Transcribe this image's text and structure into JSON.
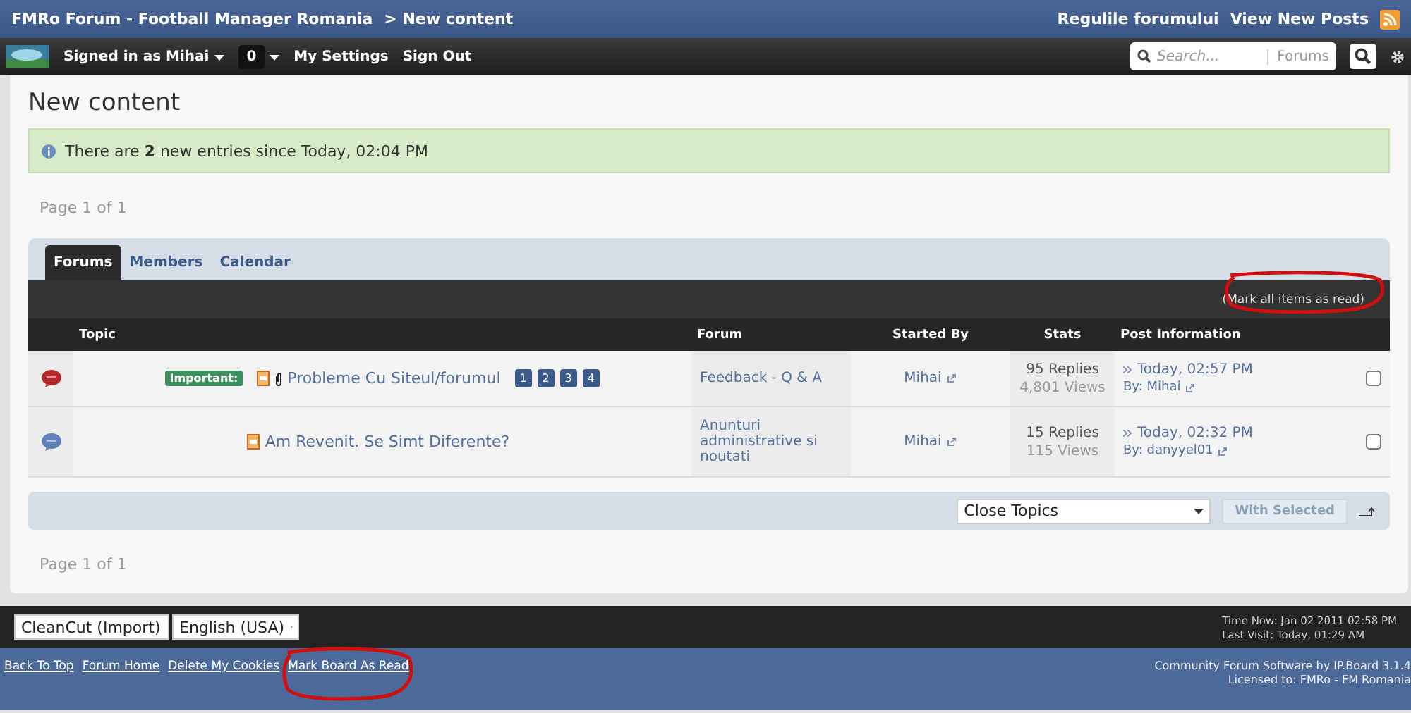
{
  "header": {
    "breadcrumb": "FMRo Forum - Football Manager Romania",
    "current": "> New content",
    "links": [
      "Regulile forumului",
      "View New Posts"
    ]
  },
  "user_bar": {
    "signed_in": "Signed in as Mihai",
    "notifications": "0",
    "links": [
      "My Settings",
      "Sign Out"
    ],
    "search": {
      "placeholder": "Search...",
      "scope": "Forums"
    }
  },
  "page": {
    "title": "New content",
    "message": "There are **2** new entries since Today, 02:04 PM",
    "pagination_top": "Page 1 of 1",
    "pagination_bottom": "Page 1 of 1"
  },
  "tabs": [
    {
      "label": "Forums",
      "selected": true
    },
    {
      "label": "Members",
      "selected": false
    },
    {
      "label": "Calendar",
      "selected": false
    }
  ],
  "mark_all": {
    "label": "(Mark all items as read)",
    "circled": true
  },
  "columns": [
    "Topic",
    "Forum",
    "Started By",
    "Stats",
    "Post Information"
  ],
  "topics": [
    {
      "color": "#b8282a",
      "badge": "Important:",
      "attachment": true,
      "title": "Probleme Cu Siteul/forumul",
      "pages": [
        "1",
        "2",
        "3",
        "4"
      ],
      "forum": "Feedback - Q & A",
      "starter": "Mihai",
      "replies": "95 Replies",
      "views": "4,801 Views",
      "last": "Today, 02:57 PM",
      "by": "By: Mihai",
      "checked": false
    },
    {
      "color": "#5f82b8",
      "attachment": false,
      "title": "Am Revenit. Se Simt Diferente?",
      "forum": "Anunturi administrative si noutati",
      "starter": "Mihai",
      "replies": "15 Replies",
      "views": "115 Views",
      "last": "Today, 02:32 PM",
      "by": "By: danyyel01",
      "checked": false
    }
  ],
  "moderation": {
    "action": "Close Topics",
    "button": "With Selected"
  },
  "footer": {
    "skin": "CleanCut (Import)",
    "language": "English (USA)",
    "time_now": "Time Now: Jan 02 2011 02:58 PM",
    "last_visit": "Last Visit: Today, 01:29 AM",
    "links": [
      {
        "label": "Back To Top",
        "circled": false
      },
      {
        "label": "Forum Home",
        "circled": false
      },
      {
        "label": "Delete My Cookies",
        "circled": false
      },
      {
        "label": "Mark Board As Read",
        "circled": true
      }
    ],
    "credit": "Community Forum Software by IP.Board 3.1.4",
    "license": "Licensed to: FMRo - FM Romania"
  }
}
